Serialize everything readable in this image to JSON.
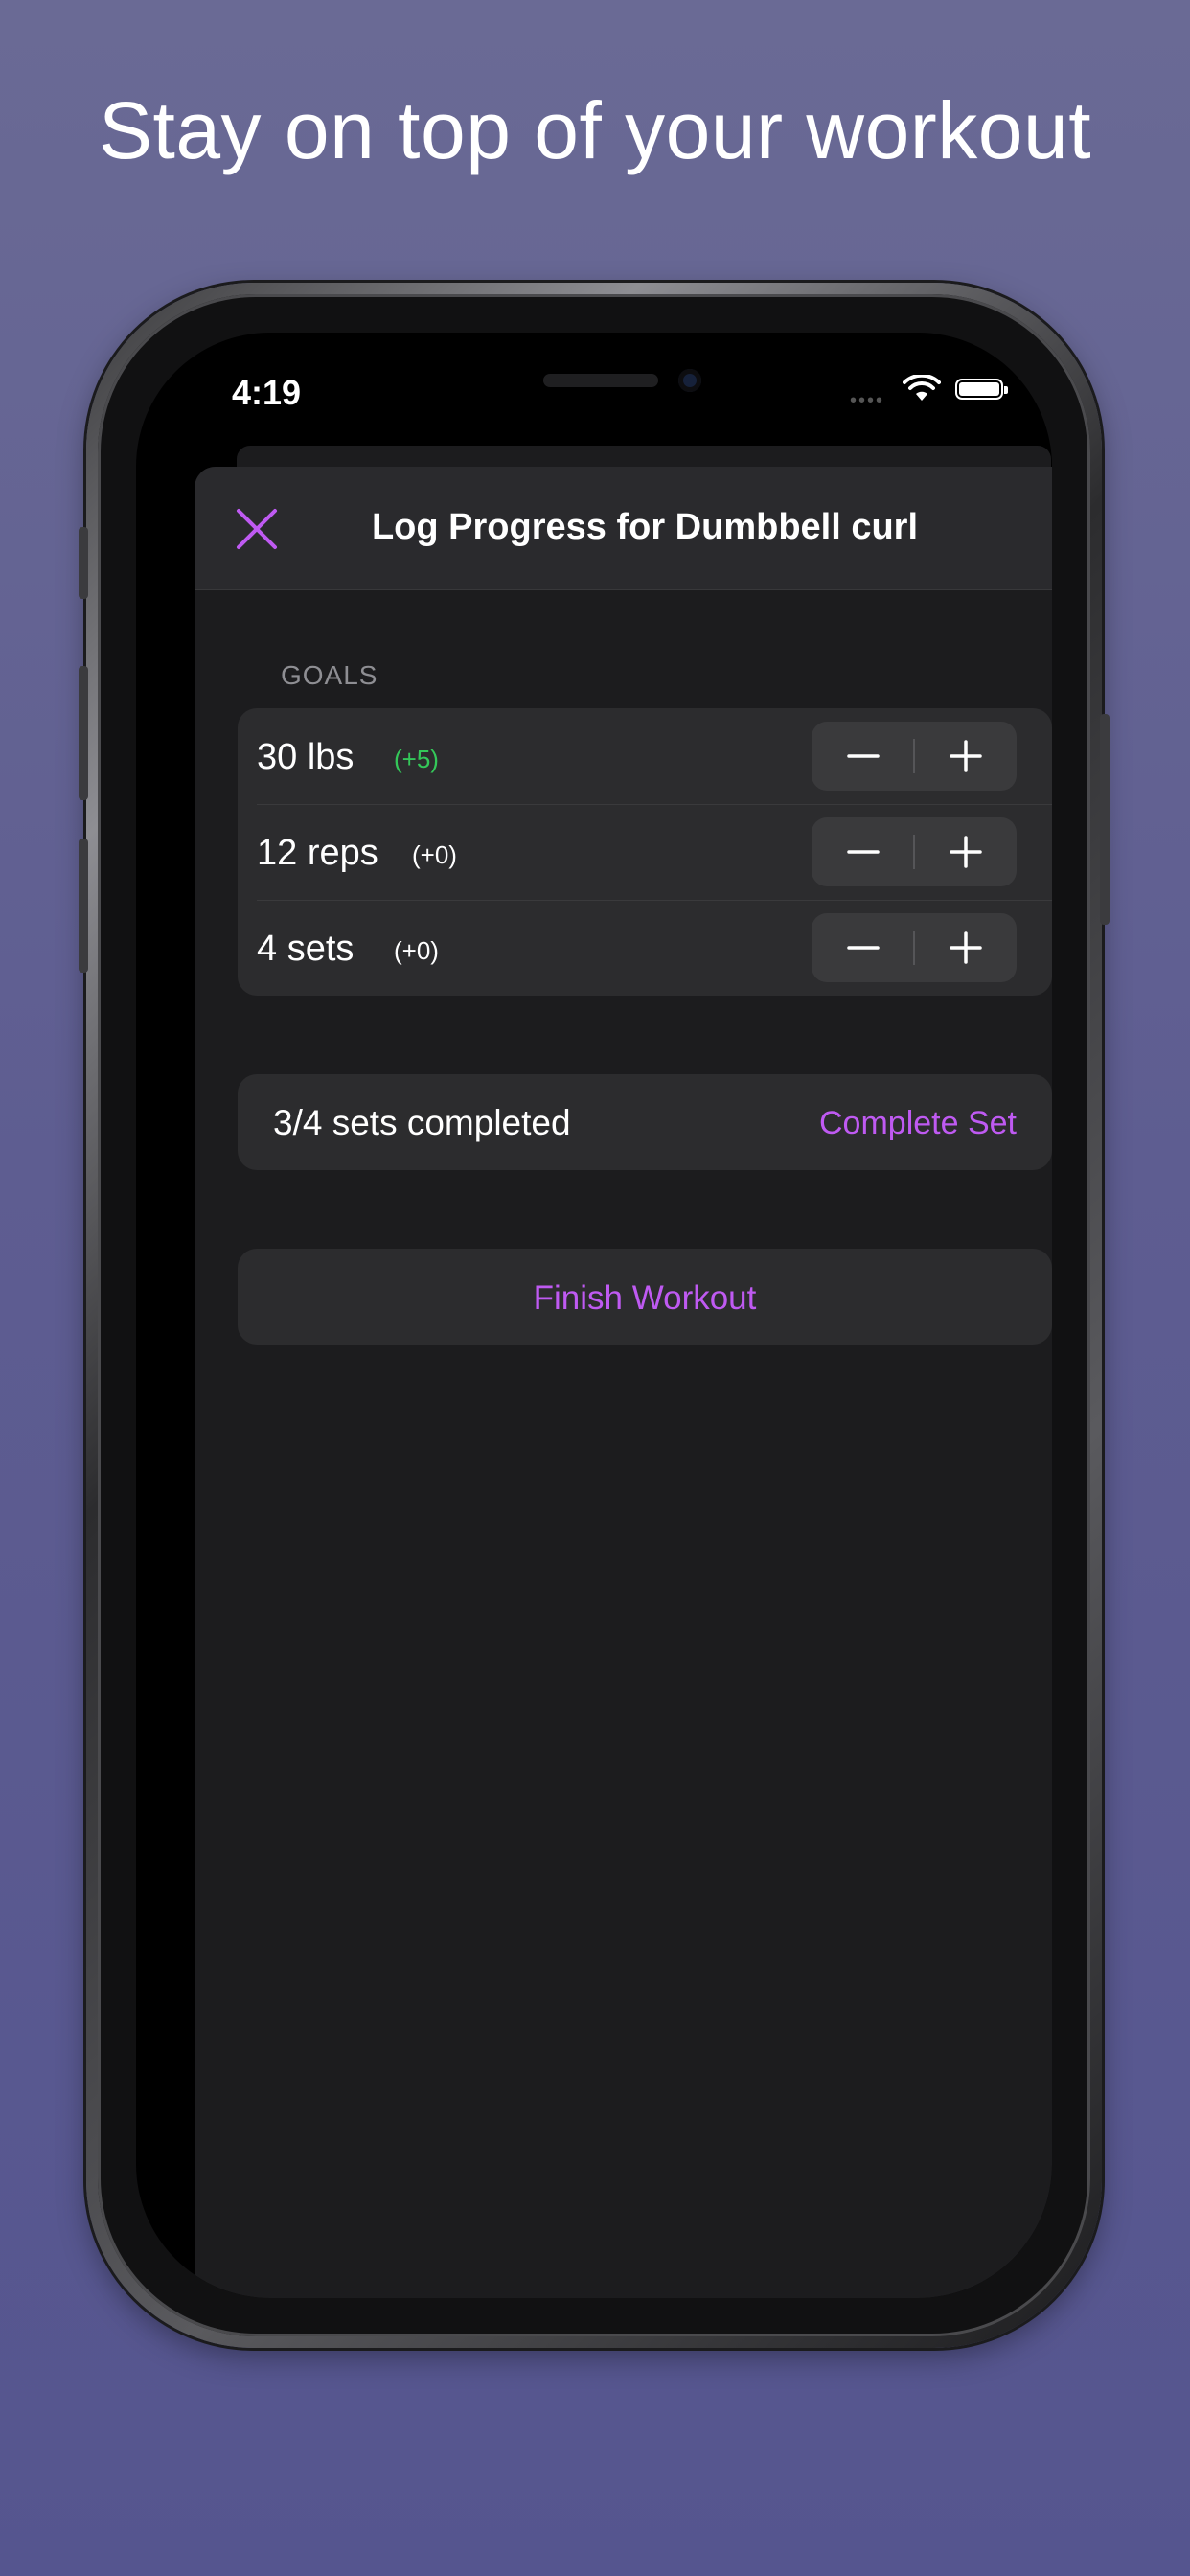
{
  "headline": "Stay on top of your workout",
  "status_bar": {
    "time": "4:19"
  },
  "nav": {
    "title": "Log Progress for Dumbbell curl"
  },
  "goals": {
    "section_label": "GOALS",
    "rows": [
      {
        "value": "30 lbs",
        "delta": "(+5)",
        "delta_color": "#34c759"
      },
      {
        "value": "12 reps",
        "delta": "(+0)",
        "delta_color": "#ffffff"
      },
      {
        "value": "4 sets",
        "delta": "(+0)",
        "delta_color": "#ffffff"
      }
    ]
  },
  "progress": {
    "text": "3/4 sets completed",
    "action_label": "Complete Set"
  },
  "finish": {
    "label": "Finish Workout"
  },
  "colors": {
    "accent": "#bf5af2",
    "positive": "#34c759",
    "background": "#5e5d91"
  },
  "icons": {
    "close": "close-icon",
    "minus": "minus-icon",
    "plus": "plus-icon"
  }
}
